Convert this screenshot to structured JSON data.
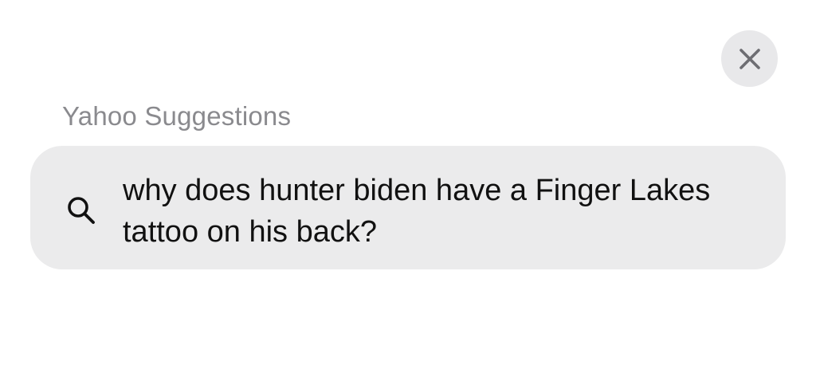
{
  "close": {
    "icon": "close-icon"
  },
  "section": {
    "title": "Yahoo Suggestions"
  },
  "suggestions": [
    {
      "icon": "search-icon",
      "text": "why does hunter biden have a Finger Lakes tattoo on his back?"
    }
  ]
}
